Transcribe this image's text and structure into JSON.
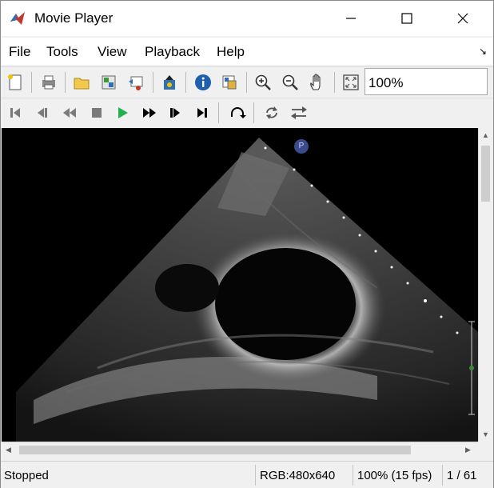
{
  "window": {
    "title": "Movie Player"
  },
  "menu": [
    "File",
    "Tools",
    "View",
    "Playback",
    "Help"
  ],
  "toolbar": {
    "zoom_value": "100%"
  },
  "status": {
    "state": "Stopped",
    "format": "RGB:480x640",
    "zoom_fps": "100% (15 fps)",
    "frame": "1 / 61"
  },
  "video": {
    "overlay_marker": "P"
  },
  "colors": {
    "play_green": "#22b14c",
    "window_bg": "#f0f0f0",
    "video_bg": "#000000"
  }
}
